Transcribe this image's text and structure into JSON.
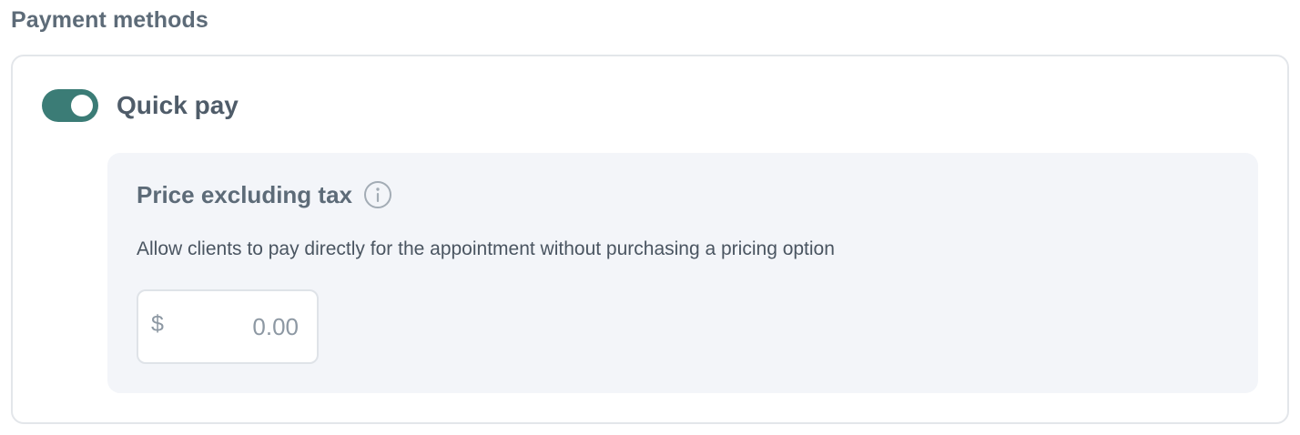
{
  "section": {
    "title": "Payment methods"
  },
  "quick_pay": {
    "label": "Quick pay",
    "enabled": true
  },
  "price": {
    "title": "Price excluding tax",
    "info_icon": "info-icon",
    "description": "Allow clients to pay directly for the appointment without purchasing a pricing option",
    "currency_symbol": "$",
    "value": "",
    "placeholder": "0.00"
  },
  "colors": {
    "accent": "#3b7c76",
    "panel_background": "#f3f5f9",
    "text_muted": "#5d6b78"
  }
}
